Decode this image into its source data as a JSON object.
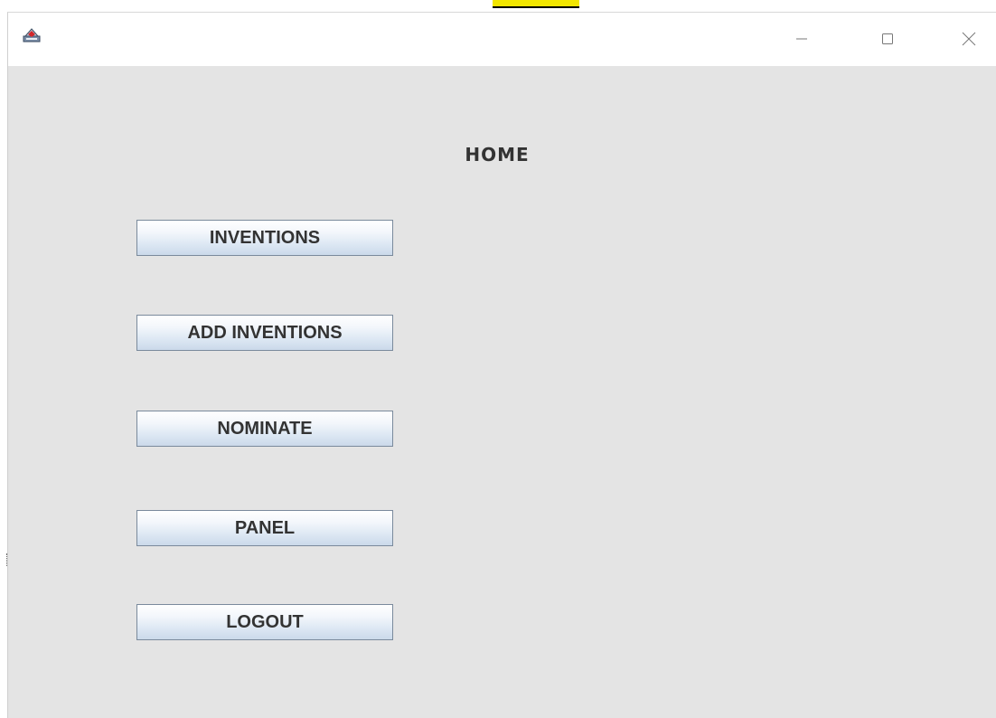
{
  "window": {
    "title": "",
    "icon": "java-app-icon",
    "controls": {
      "minimize_icon": "minimize-icon",
      "maximize_icon": "maximize-icon",
      "close_icon": "close-icon"
    }
  },
  "main": {
    "heading": "HOME",
    "buttons": [
      {
        "label": "INVENTIONS"
      },
      {
        "label": "ADD INVENTIONS"
      },
      {
        "label": "NOMINATE"
      },
      {
        "label": "PANEL"
      },
      {
        "label": "LOGOUT"
      }
    ]
  },
  "colors": {
    "background": "#e4e4e4",
    "titlebar": "#ffffff",
    "button_border": "#7a8a9c",
    "button_gradient_bottom": "#cbd9ea",
    "highlight": "#f2e600"
  }
}
